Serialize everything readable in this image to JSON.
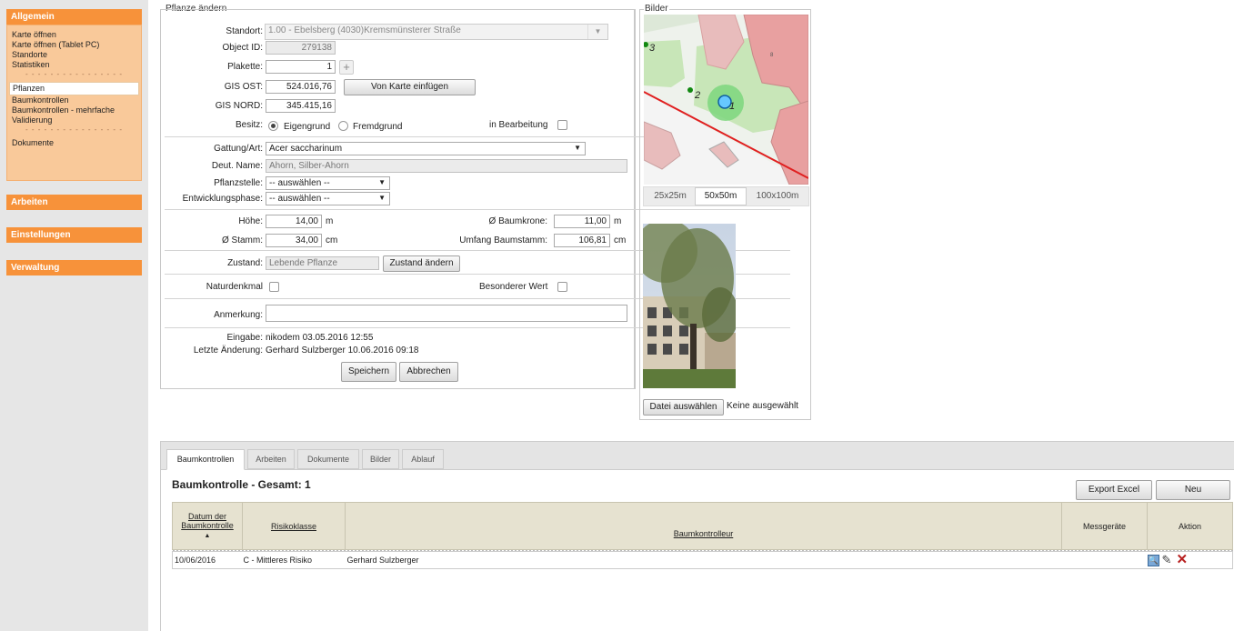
{
  "sidebar": {
    "sections": {
      "allgemein": "Allgemein",
      "arbeiten": "Arbeiten",
      "einstellungen": "Einstellungen",
      "verwaltung": "Verwaltung"
    },
    "items": [
      "Karte öffnen",
      "Karte öffnen (Tablet PC)",
      "Standorte",
      "Statistiken",
      "Pflanzen",
      "Baumkontrollen",
      "Baumkontrollen - mehrfache",
      "Validierung",
      "Dokumente"
    ],
    "dots": "- - - - - - - - - - - - - - - -"
  },
  "form": {
    "legend": "Pflanze ändern",
    "standort_label": "Standort:",
    "standort_value": "1.00 - Ebelsberg (4030)Kremsmünsterer Straße",
    "object_id_label": "Object ID:",
    "object_id_value": "279138",
    "plakette_label": "Plakette:",
    "plakette_value": "1",
    "gis_ost_label": "GIS OST:",
    "gis_ost_value": "524.016,76",
    "von_karte_button": "Von Karte einfügen",
    "gis_nord_label": "GIS NORD:",
    "gis_nord_value": "345.415,16",
    "besitz_label": "Besitz:",
    "eigengrund_label": "Eigengrund",
    "fremdgrund_label": "Fremdgrund",
    "in_bearbeitung_label": "in Bearbeitung",
    "gattung_label": "Gattung/Art:",
    "gattung_value": "Acer saccharinum",
    "deut_name_label": "Deut. Name:",
    "deut_name_value": "Ahorn, Silber-Ahorn",
    "pflanzstelle_label": "Pflanzstelle:",
    "pflanzstelle_value": "-- auswählen --",
    "entwicklung_label": "Entwicklungsphase:",
    "entwicklung_value": "-- auswählen --",
    "hoehe_label": "Höhe:",
    "hoehe_value": "14,00",
    "hoehe_unit": "m",
    "krone_label": "Ø Baumkrone:",
    "krone_value": "11,00",
    "krone_unit": "m",
    "stamm_label": "Ø Stamm:",
    "stamm_value": "34,00",
    "stamm_unit": "cm",
    "umfang_label": "Umfang Baumstamm:",
    "umfang_value": "106,81",
    "umfang_unit": "cm",
    "zustand_label": "Zustand:",
    "zustand_value": "Lebende Pflanze",
    "zustand_button": "Zustand ändern",
    "naturdenkmal_label": "Naturdenkmal",
    "besonderer_wert_label": "Besonderer Wert",
    "anmerkung_label": "Anmerkung:",
    "anmerkung_value": "",
    "eingabe_label": "Eingabe:",
    "eingabe_value": "nikodem 03.05.2016 12:55",
    "letzte_label": "Letzte Änderung:",
    "letzte_value": "Gerhard Sulzberger 10.06.2016 09:18",
    "save_button": "Speichern",
    "cancel_button": "Abbrechen"
  },
  "bilder": {
    "legend": "Bilder",
    "map_labels": [
      "3",
      "2",
      "1",
      "8"
    ],
    "scale_buttons": [
      "25x25m",
      "50x50m",
      "100x100m"
    ],
    "active_scale": "50x50m",
    "file_button": "Datei auswählen",
    "file_status": "Keine ausgewählt"
  },
  "tabs": [
    "Baumkontrollen",
    "Arbeiten",
    "Dokumente",
    "Bilder",
    "Ablauf"
  ],
  "table": {
    "title": "Baumkontrolle - Gesamt: 1",
    "export_button": "Export Excel",
    "new_button": "Neu",
    "headers": {
      "datum_line1": "Datum der",
      "datum_line2": "Baumkontrolle",
      "sort_indicator": "▲",
      "risikoklasse": "Risikoklasse",
      "kontrolleur": "Baumkontrolleur",
      "messgeraete": "Messgeräte",
      "aktion": "Aktion"
    },
    "rows": [
      {
        "datum": "10/06/2016",
        "risiko": "C - Mittleres Risiko",
        "kontrolleur": "Gerhard Sulzberger",
        "messgeraete": ""
      }
    ]
  },
  "colors": {
    "accent": "#f7923a",
    "menu_bg": "#f9c99a",
    "map_green": "#c8e6b8",
    "map_red": "#e8a0a0"
  }
}
